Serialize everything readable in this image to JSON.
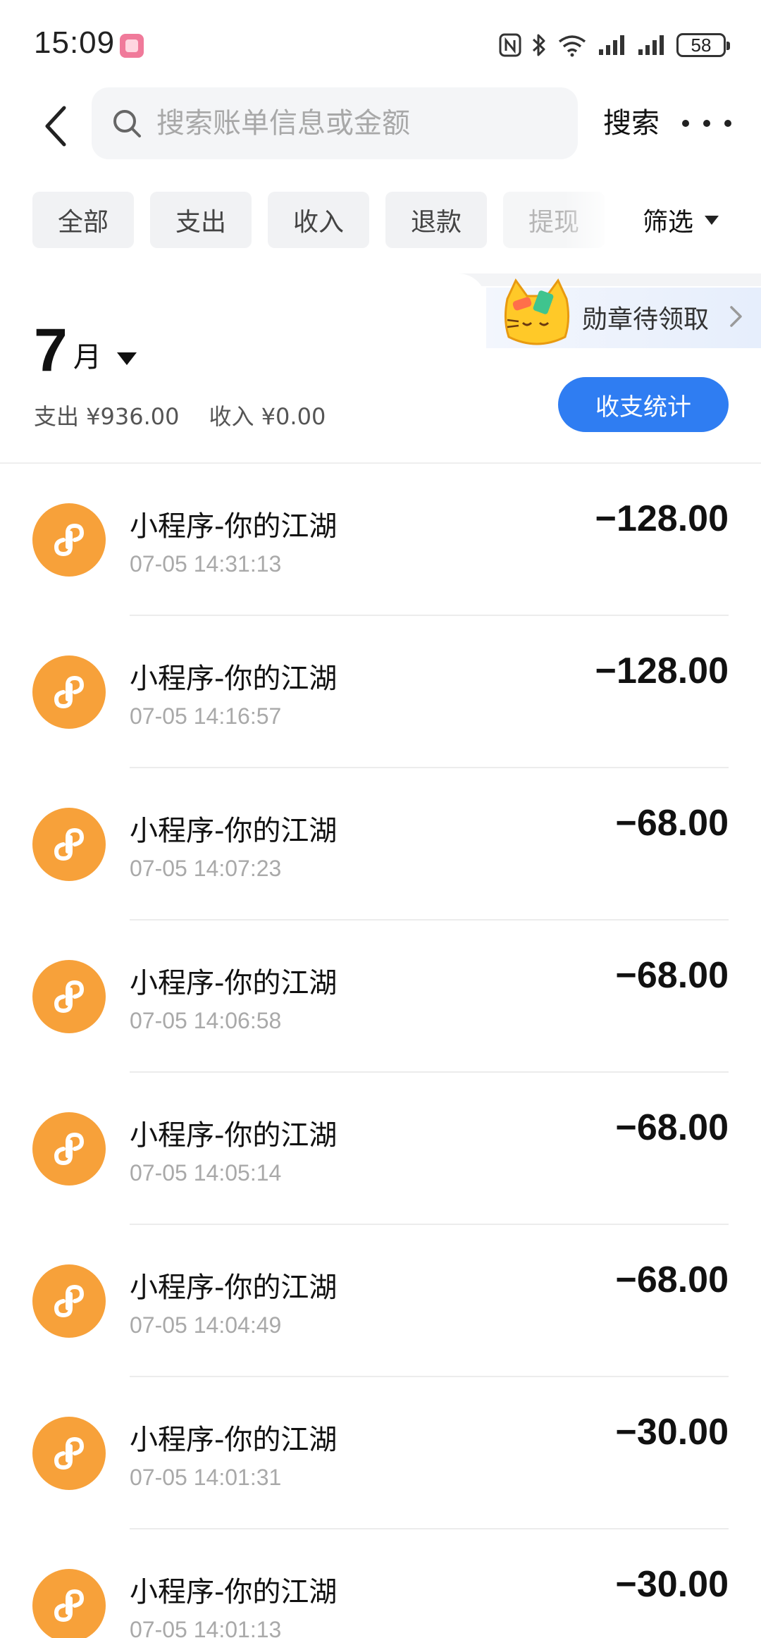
{
  "status_bar": {
    "time": "15:09",
    "battery": "58",
    "icons": [
      "nfc-icon",
      "bluetooth-icon",
      "wifi-icon",
      "signal-icon",
      "signal-icon",
      "battery-icon"
    ]
  },
  "header": {
    "search_placeholder": "搜索账单信息或金额",
    "search_label": "搜索"
  },
  "filters": {
    "chips": [
      "全部",
      "支出",
      "收入",
      "退款",
      "提现"
    ],
    "filter_label": "筛选"
  },
  "badge": {
    "text": "勋章待领取"
  },
  "summary": {
    "month_number": "7",
    "month_unit": "月",
    "expense": "支出 ¥936.00",
    "income": "收入 ¥0.00",
    "stats_button": "收支统计"
  },
  "transactions": [
    {
      "title": "小程序-你的江湖",
      "time": "07-05 14:31:13",
      "amount": "−128.00"
    },
    {
      "title": "小程序-你的江湖",
      "time": "07-05 14:16:57",
      "amount": "−128.00"
    },
    {
      "title": "小程序-你的江湖",
      "time": "07-05 14:07:23",
      "amount": "−68.00"
    },
    {
      "title": "小程序-你的江湖",
      "time": "07-05 14:06:58",
      "amount": "−68.00"
    },
    {
      "title": "小程序-你的江湖",
      "time": "07-05 14:05:14",
      "amount": "−68.00"
    },
    {
      "title": "小程序-你的江湖",
      "time": "07-05 14:04:49",
      "amount": "−68.00"
    },
    {
      "title": "小程序-你的江湖",
      "time": "07-05 14:01:31",
      "amount": "−30.00"
    },
    {
      "title": "小程序-你的江湖",
      "time": "07-05 14:01:13",
      "amount": "−30.00"
    }
  ],
  "colors": {
    "accent": "#2f7df2",
    "mini_program_icon": "#f7a13a",
    "secondary_text": "#a9a9a9"
  }
}
